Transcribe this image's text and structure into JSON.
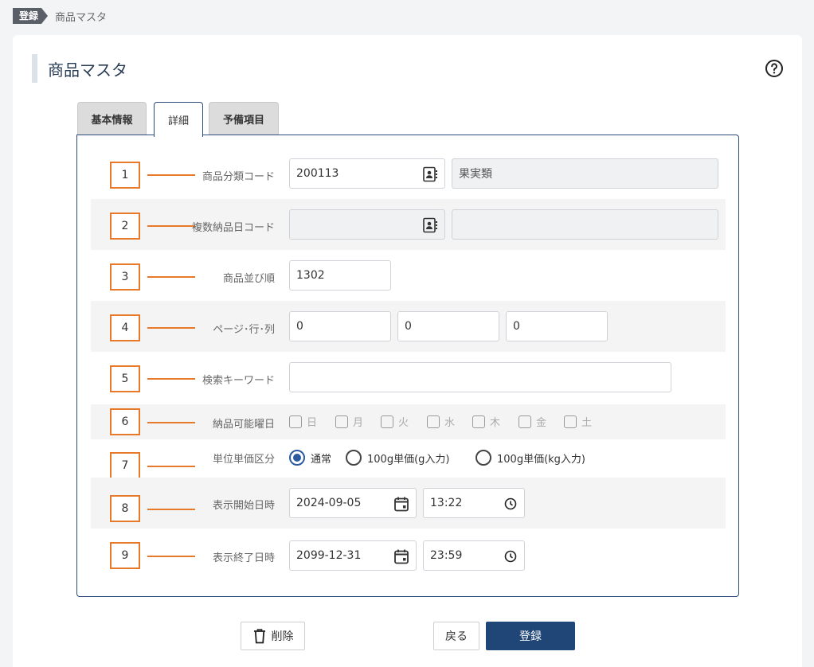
{
  "breadcrumb": {
    "tag": "登録",
    "page": "商品マスタ"
  },
  "page": {
    "title": "商品マスタ"
  },
  "tabs": [
    {
      "label": "基本情報"
    },
    {
      "label": "詳細"
    },
    {
      "label": "予備項目"
    }
  ],
  "rows": {
    "r1": {
      "num": "1",
      "label": "商品分類コード",
      "code": "200113",
      "name": "果実類"
    },
    "r2": {
      "num": "2",
      "label": "複数納品日コード",
      "code": "",
      "name": ""
    },
    "r3": {
      "num": "3",
      "label": "商品並び順",
      "value": "1302"
    },
    "r4": {
      "num": "4",
      "label": "ページ･行･列",
      "page": "0",
      "row": "0",
      "col": "0"
    },
    "r5": {
      "num": "5",
      "label": "検索キーワード",
      "value": ""
    },
    "r6": {
      "num": "6",
      "label": "納品可能曜日",
      "days": [
        "日",
        "月",
        "火",
        "水",
        "木",
        "金",
        "土"
      ]
    },
    "r7": {
      "num": "7",
      "label": "単位単価区分",
      "options": [
        "通常",
        "100g単価(g入力)",
        "100g単価(kg入力)"
      ],
      "selected": "通常"
    },
    "r8": {
      "num": "8",
      "label": "表示開始日時",
      "date": "2024-09-05",
      "time": "13:22"
    },
    "r9": {
      "num": "9",
      "label": "表示終了日時",
      "date": "2099-12-31",
      "time": "23:59"
    }
  },
  "buttons": {
    "delete": "削除",
    "back": "戻る",
    "register": "登録"
  },
  "icons": {
    "lookup": "contact-book-icon",
    "calendar": "calendar-icon",
    "clock": "clock-icon",
    "help": "help-circle-icon",
    "trash": "trash-icon"
  },
  "colors": {
    "accent": "#e67a2a",
    "primary": "#1f4677",
    "border": "#2c4a7a"
  }
}
